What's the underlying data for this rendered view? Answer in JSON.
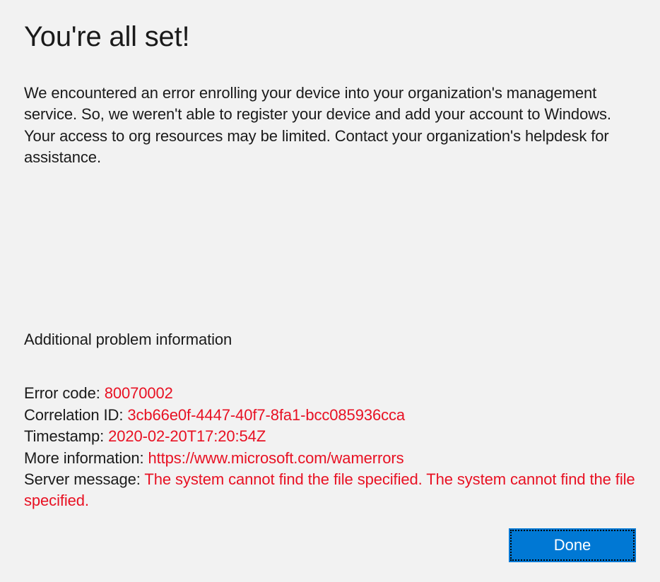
{
  "heading": "You're all set!",
  "body": "We encountered an error enrolling your device into your organization's management service. So, we weren't able to register your device and add your account to Windows. Your access to org resources may be limited. Contact your organization's helpdesk for assistance.",
  "subheading": "Additional problem information",
  "details": {
    "error_code_label": "Error code: ",
    "error_code_value": "80070002",
    "correlation_id_label": "Correlation ID: ",
    "correlation_id_value": "3cb66e0f-4447-40f7-8fa1-bcc085936cca",
    "timestamp_label": "Timestamp: ",
    "timestamp_value": "2020-02-20T17:20:54Z",
    "more_info_label": "More information: ",
    "more_info_value": "https://www.microsoft.com/wamerrors",
    "server_message_label": "Server message: ",
    "server_message_value": "The system cannot find the file specified. The system cannot find the file specified."
  },
  "button": {
    "done_label": "Done"
  }
}
